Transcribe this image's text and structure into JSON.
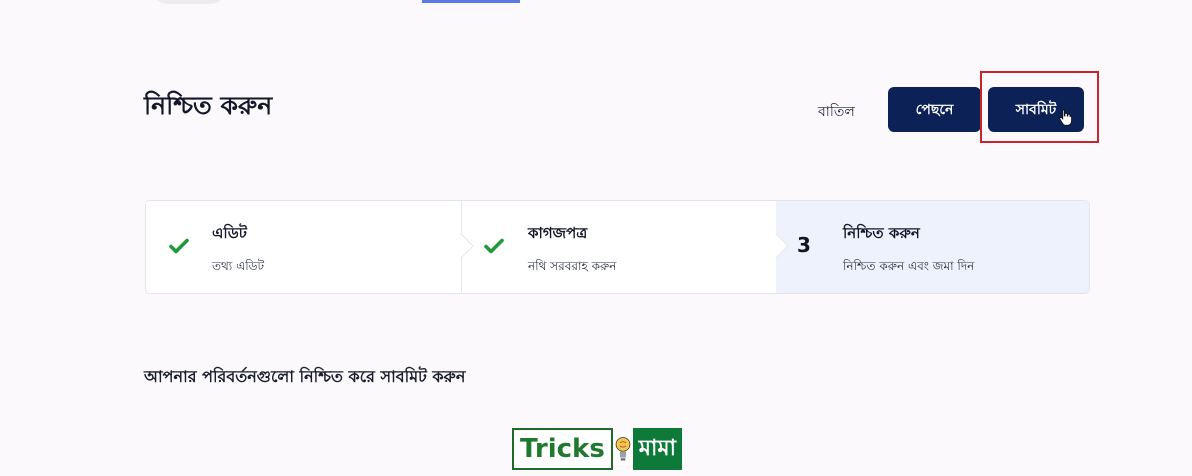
{
  "header": {
    "title": "নিশ্চিত করুন"
  },
  "actions": {
    "cancel_label": "বাতিল",
    "back_label": "পেছনে",
    "submit_label": "সাবমিট"
  },
  "stepper": {
    "steps": [
      {
        "title": "এডিট",
        "subtitle": "তথ্য এডিট",
        "status": "completed",
        "icon": "check-icon"
      },
      {
        "title": "কাগজপত্র",
        "subtitle": "নথি সরবরাহ করুন",
        "status": "completed",
        "icon": "check-icon"
      },
      {
        "number": "3",
        "title": "নিশ্চিত করুন",
        "subtitle": "নিশ্চিত করুন এবং জমা দিন",
        "status": "active"
      }
    ]
  },
  "message": "আপনার পরিবর্তনগুলো নিশ্চিত করে সাবমিট করুন",
  "watermark": {
    "left_text": "Tricks",
    "right_text": "মামা"
  },
  "colors": {
    "primary_button": "#0c2256",
    "check": "#1f9a3b",
    "active_step_bg": "#edf2fd",
    "highlight": "#c8242b"
  }
}
